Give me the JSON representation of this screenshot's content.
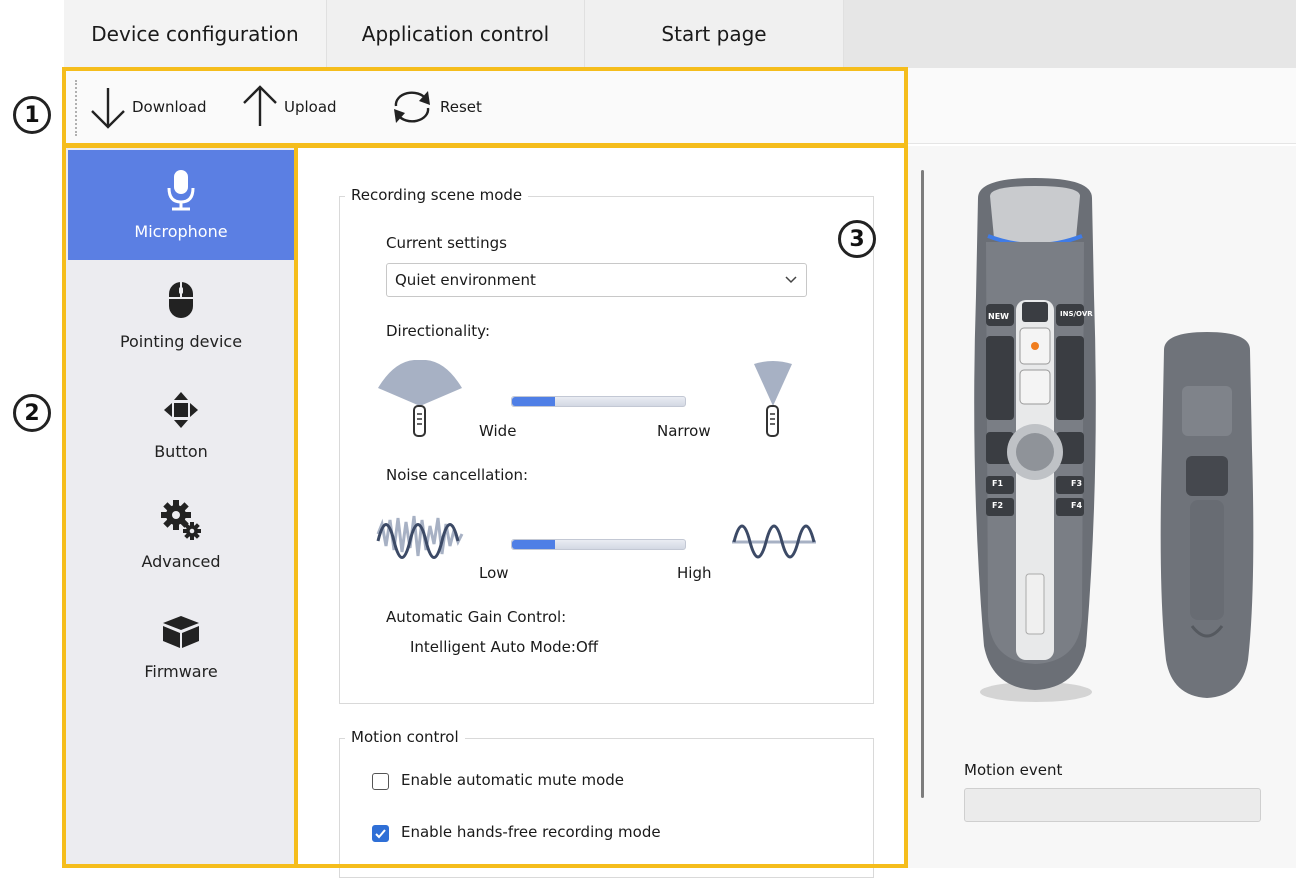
{
  "tabs": [
    {
      "label": "Device configuration",
      "active": true
    },
    {
      "label": "Application control",
      "active": false
    },
    {
      "label": "Start page",
      "active": false
    }
  ],
  "toolbar": {
    "download_label": "Download",
    "upload_label": "Upload",
    "reset_label": "Reset"
  },
  "sidebar": {
    "items": [
      {
        "label": "Microphone",
        "icon": "microphone-icon",
        "active": true
      },
      {
        "label": "Pointing device",
        "icon": "mouse-icon",
        "active": false
      },
      {
        "label": "Button",
        "icon": "directional-pad-icon",
        "active": false
      },
      {
        "label": "Advanced",
        "icon": "gears-icon",
        "active": false
      },
      {
        "label": "Firmware",
        "icon": "box-icon",
        "active": false
      }
    ]
  },
  "recording_scene": {
    "title": "Recording scene mode",
    "current_settings_label": "Current settings",
    "current_settings_value": "Quiet environment",
    "directionality_label": "Directionality:",
    "directionality_min": "Wide",
    "directionality_max": "Narrow",
    "directionality_level": 0.25,
    "noise_label": "Noise cancellation:",
    "noise_min": "Low",
    "noise_max": "High",
    "noise_level": 0.25,
    "agc_label": "Automatic Gain Control:",
    "agc_value": "Intelligent Auto Mode:Off"
  },
  "motion_control": {
    "title": "Motion control",
    "auto_mute_label": "Enable automatic mute mode",
    "auto_mute_checked": false,
    "hands_free_label": "Enable hands-free recording mode",
    "hands_free_checked": true
  },
  "preview": {
    "motion_event_label": "Motion event",
    "motion_event_value": "",
    "device_buttons": [
      "NEW",
      "INS/OVR",
      "F1",
      "F2",
      "F3",
      "F4"
    ]
  },
  "annotations": {
    "badge_1": "1",
    "badge_2": "2",
    "badge_3": "3"
  },
  "colors": {
    "accent": "#5b7fe3",
    "highlight_frame": "#f5bd1c",
    "checkbox_checked": "#2f6fd6"
  }
}
